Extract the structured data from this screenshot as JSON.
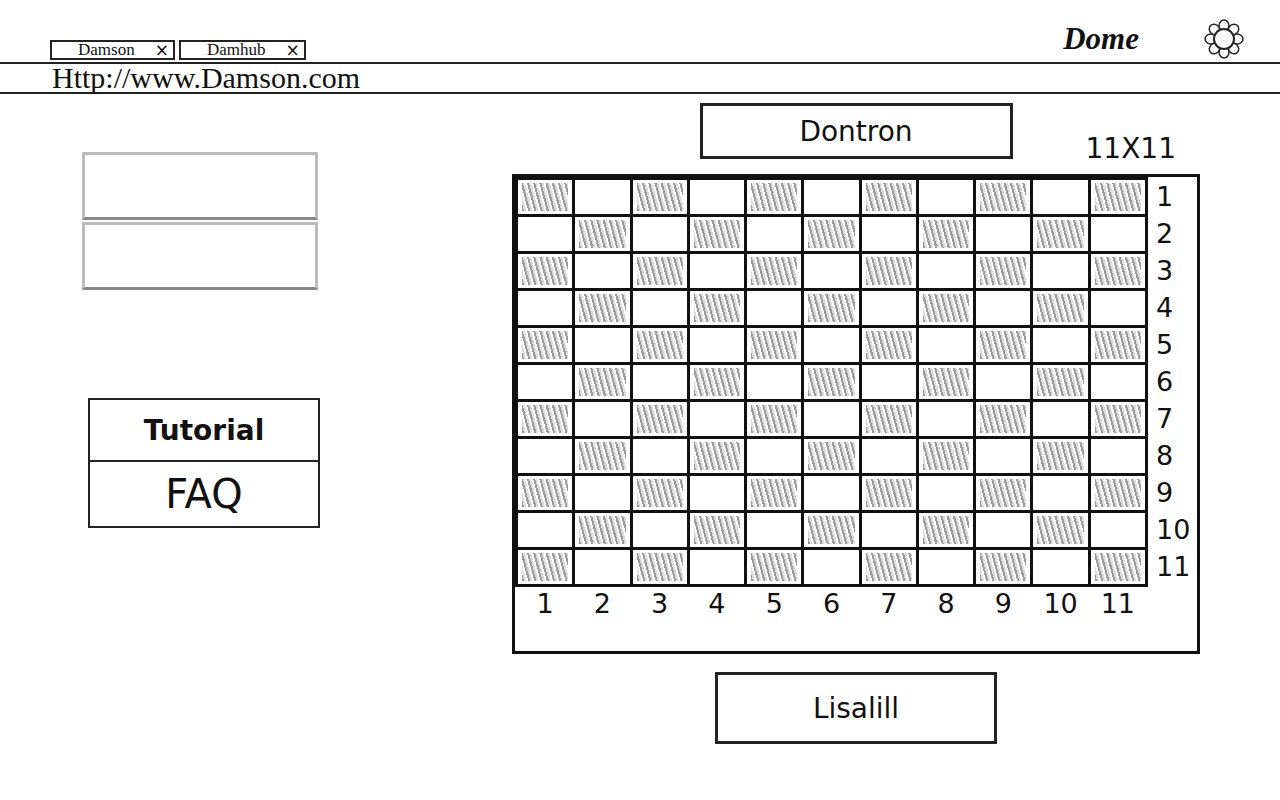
{
  "browser": {
    "tabs": [
      {
        "label": "Damson",
        "close": "×"
      },
      {
        "label": "Damhub",
        "close": "×"
      }
    ],
    "url": "Http://www.Damson.com"
  },
  "brand": {
    "name": "Dome"
  },
  "form": {
    "fields": [
      {
        "value": ""
      },
      {
        "value": ""
      }
    ]
  },
  "side_buttons": [
    "Tutorial",
    "FAQ"
  ],
  "board": {
    "top_player": "Dontron",
    "size": "11X11",
    "row_labels": [
      "1",
      "2",
      "3",
      "4",
      "5",
      "6",
      "7",
      "8",
      "9",
      "10",
      "11"
    ],
    "column_labels": [
      "1",
      "2",
      "3",
      "4",
      "5",
      "6",
      "7",
      "8",
      "9",
      "10",
      "11"
    ],
    "rows": [
      {
        "scribbled": [
          true,
          false,
          true,
          false,
          true,
          false,
          true,
          false,
          true,
          false,
          true
        ]
      },
      {
        "scribbled": [
          false,
          true,
          false,
          true,
          false,
          true,
          false,
          true,
          false,
          true,
          false
        ]
      },
      {
        "scribbled": [
          true,
          false,
          true,
          false,
          true,
          false,
          true,
          false,
          true,
          false,
          true
        ]
      },
      {
        "scribbled": [
          false,
          true,
          false,
          true,
          false,
          true,
          false,
          true,
          false,
          true,
          false
        ]
      },
      {
        "scribbled": [
          true,
          false,
          true,
          false,
          true,
          false,
          true,
          false,
          true,
          false,
          true
        ]
      },
      {
        "scribbled": [
          false,
          true,
          false,
          true,
          false,
          true,
          false,
          true,
          false,
          true,
          false
        ]
      },
      {
        "scribbled": [
          true,
          false,
          true,
          false,
          true,
          false,
          true,
          false,
          true,
          false,
          true
        ]
      },
      {
        "scribbled": [
          false,
          true,
          false,
          true,
          false,
          true,
          false,
          true,
          false,
          true,
          false
        ]
      },
      {
        "scribbled": [
          true,
          false,
          true,
          false,
          true,
          false,
          true,
          false,
          true,
          false,
          true
        ]
      },
      {
        "scribbled": [
          false,
          true,
          false,
          true,
          false,
          true,
          false,
          true,
          false,
          true,
          false
        ]
      },
      {
        "scribbled": [
          true,
          false,
          true,
          false,
          true,
          false,
          true,
          false,
          true,
          false,
          true
        ]
      }
    ],
    "bottom_player": "Lisalill"
  }
}
